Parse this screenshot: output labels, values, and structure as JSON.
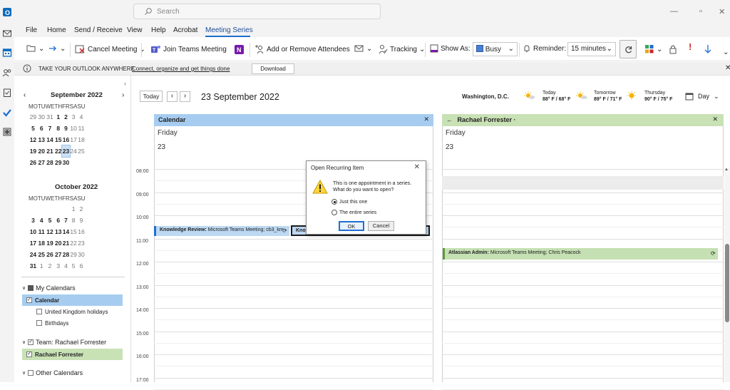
{
  "search": {
    "placeholder": "Search"
  },
  "menu": [
    "File",
    "Home",
    "Send / Receive",
    "View",
    "Help",
    "Acrobat",
    "Meeting Series"
  ],
  "ribbon": {
    "cancel_meeting": "Cancel Meeting",
    "join_teams": "Join Teams Meeting",
    "add_remove": "Add or Remove Attendees",
    "tracking": "Tracking",
    "show_as_label": "Show As:",
    "show_as_value": "Busy",
    "reminder_label": "Reminder:",
    "reminder_value": "15 minutes"
  },
  "infobar": {
    "title": "TAKE YOUR OUTLOOK ANYWHERE",
    "link": "Connect, organize and get things done",
    "button": "Download"
  },
  "mini_calendars": [
    {
      "month": "September 2022",
      "days": [
        "MO",
        "TU",
        "WE",
        "TH",
        "FR",
        "SA",
        "SU"
      ],
      "weeks": [
        [
          "29",
          "30",
          "31",
          "1",
          "2",
          "3",
          "4"
        ],
        [
          "5",
          "6",
          "7",
          "8",
          "9",
          "10",
          "11"
        ],
        [
          "12",
          "13",
          "14",
          "15",
          "16",
          "17",
          "18"
        ],
        [
          "19",
          "20",
          "21",
          "22",
          "23",
          "24",
          "25"
        ],
        [
          "26",
          "27",
          "28",
          "29",
          "30",
          "",
          ""
        ]
      ]
    },
    {
      "month": "October 2022",
      "days": [
        "MO",
        "TU",
        "WE",
        "TH",
        "FR",
        "SA",
        "SU"
      ],
      "weeks": [
        [
          "",
          "",
          "",
          "",
          "",
          "1",
          "2"
        ],
        [
          "3",
          "4",
          "5",
          "6",
          "7",
          "8",
          "9"
        ],
        [
          "10",
          "11",
          "12",
          "13",
          "14",
          "15",
          "16"
        ],
        [
          "17",
          "18",
          "19",
          "20",
          "21",
          "22",
          "23"
        ],
        [
          "24",
          "25",
          "26",
          "27",
          "28",
          "29",
          "30"
        ],
        [
          "31",
          "1",
          "2",
          "3",
          "4",
          "5",
          "6"
        ]
      ]
    }
  ],
  "calendar_groups": {
    "my_calendars": "My Calendars",
    "my_items": [
      "Calendar",
      "United Kingdom holidays",
      "Birthdays"
    ],
    "team": "Team: Rachael Forrester",
    "team_items": [
      "Rachael Forrester"
    ],
    "other": "Other Calendars"
  },
  "toolbar": {
    "today": "Today",
    "date_title": "23 September 2022",
    "location": "Washington,  D.C.",
    "view": "Day"
  },
  "weather": [
    {
      "day": "Today",
      "temps": "88° F / 68° F"
    },
    {
      "day": "Tomorrow",
      "temps": "89° F / 71° F"
    },
    {
      "day": "Thursday",
      "temps": "90° F / 75° F"
    }
  ],
  "columns": [
    {
      "name": "Calendar",
      "day": "Friday",
      "date": "23"
    },
    {
      "name": "Rachael Forrester ·",
      "day": "Friday",
      "date": "23"
    }
  ],
  "times": [
    "08:00",
    "09:00",
    "10:00",
    "11:00",
    "12:00",
    "13:00",
    "14:00",
    "15:00",
    "16:00",
    "17:00"
  ],
  "events": {
    "cal_event_title": "Knowledge Review:",
    "cal_event_rest": " Microsoft Teams Meeting; cb3_km",
    "cal_event2_title": "Kno",
    "rf_event_title": "Atlassian Admin:",
    "rf_event_rest": " Microsoft Teams Meeting; Chris Peacock"
  },
  "dialog": {
    "title": "Open Recurring Item",
    "line1": "This is one appointment in a series.",
    "line2": "What do you want to open?",
    "opt1": "Just this one",
    "opt2": "The entire series",
    "ok": "OK",
    "cancel": "Cancel",
    "selected": "Just this one"
  },
  "colors": {
    "accent": "#1f6fcf",
    "calendar_blue": "#a6cdf0",
    "team_green": "#c8e1b5",
    "event_blue": "#bcd8f2",
    "event_green": "#c5e0b3"
  }
}
